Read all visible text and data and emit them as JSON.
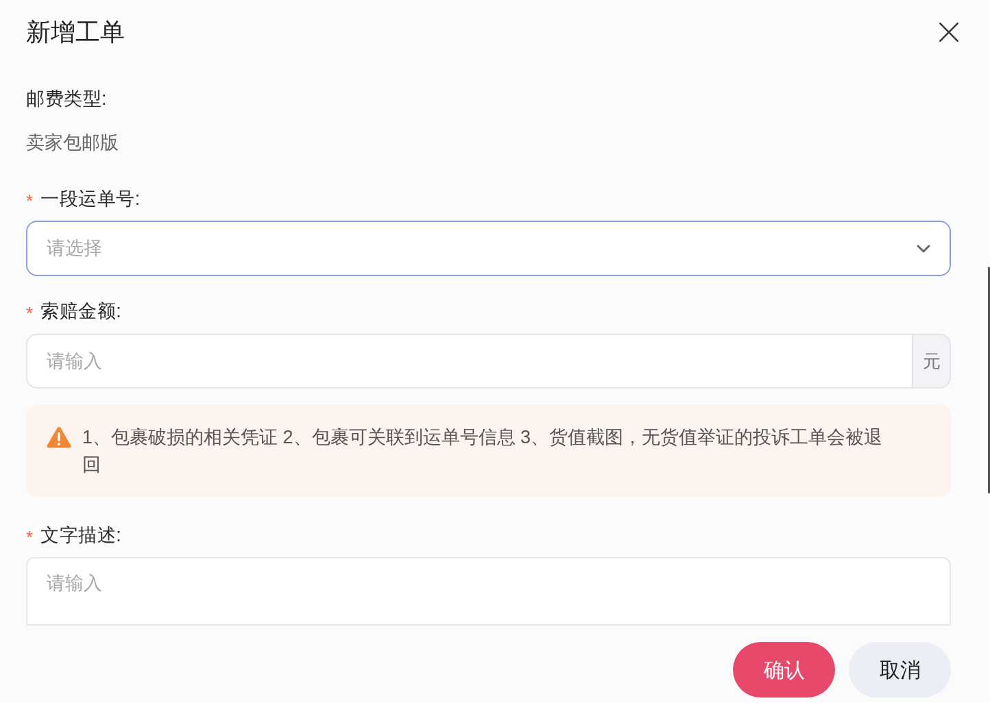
{
  "dialog": {
    "title": "新增工单"
  },
  "fields": [
    {
      "kind": "static",
      "label": "邮费类型:",
      "value": "卖家包邮版"
    },
    {
      "kind": "select",
      "required_mark": "*",
      "label": "一段运单号:",
      "placeholder": "请选择",
      "focused": true
    },
    {
      "kind": "input",
      "required_mark": "*",
      "label": "索赔金额:",
      "placeholder": "请输入",
      "suffix": "元"
    },
    {
      "kind": "notice",
      "text": "1、包裹破损的相关凭证 2、包裹可关联到运单号信息 3、货值截图，无货值举证的投诉工单会被退回"
    },
    {
      "kind": "textarea",
      "required_mark": "*",
      "label": "文字描述:",
      "placeholder": "请输入"
    }
  ],
  "buttons": [
    {
      "label": "确认",
      "kind": "primary"
    },
    {
      "label": "取消",
      "kind": "secondary"
    }
  ]
}
